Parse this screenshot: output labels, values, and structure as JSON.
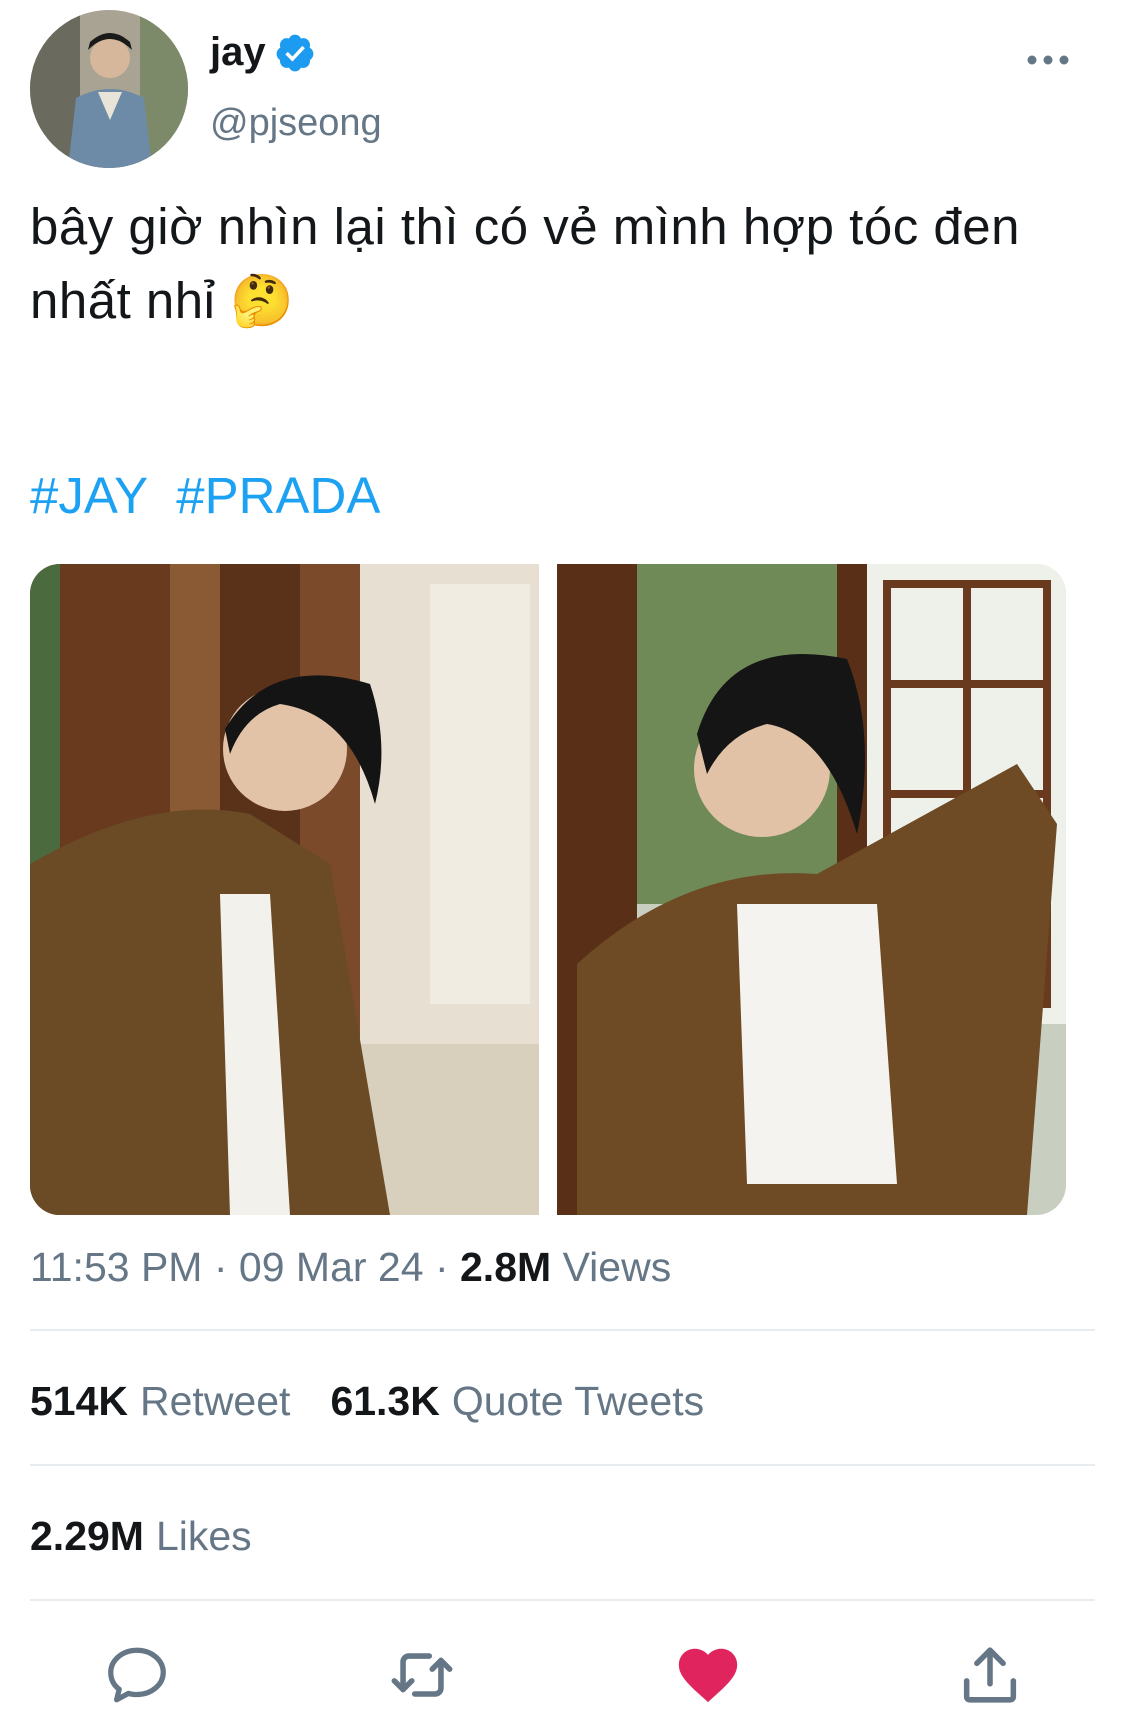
{
  "author": {
    "name": "jay",
    "handle": "@pjseong",
    "verified": true,
    "verified_color": "#1d9bf0"
  },
  "tweet": {
    "text": "bây giờ nhìn lại thì có vẻ mình hợp tóc đen nhất nhỉ 🤔",
    "hashtags": [
      "#JAY",
      "#PRADA"
    ],
    "hashtag_color": "#1da1f2",
    "images": [
      {
        "icon": "photo-man-in-brown-jacket-by-calligraphy-scroll"
      },
      {
        "icon": "photo-man-in-brown-jacket-by-window"
      }
    ]
  },
  "meta": {
    "time": "11:53 PM",
    "date": "09 Mar 24",
    "separator": "·",
    "views_count": "2.8M",
    "views_label": "Views"
  },
  "stats": {
    "retweets_count": "514K",
    "retweets_label": "Retweet",
    "quotes_count": "61.3K",
    "quotes_label": "Quote Tweets",
    "likes_count": "2.29M",
    "likes_label": "Likes"
  },
  "actions": {
    "reply_icon": "reply-icon",
    "retweet_icon": "retweet-icon",
    "like_icon": "heart-icon",
    "like_color": "#e0245e",
    "share_icon": "share-icon",
    "icon_color": "#657786"
  }
}
